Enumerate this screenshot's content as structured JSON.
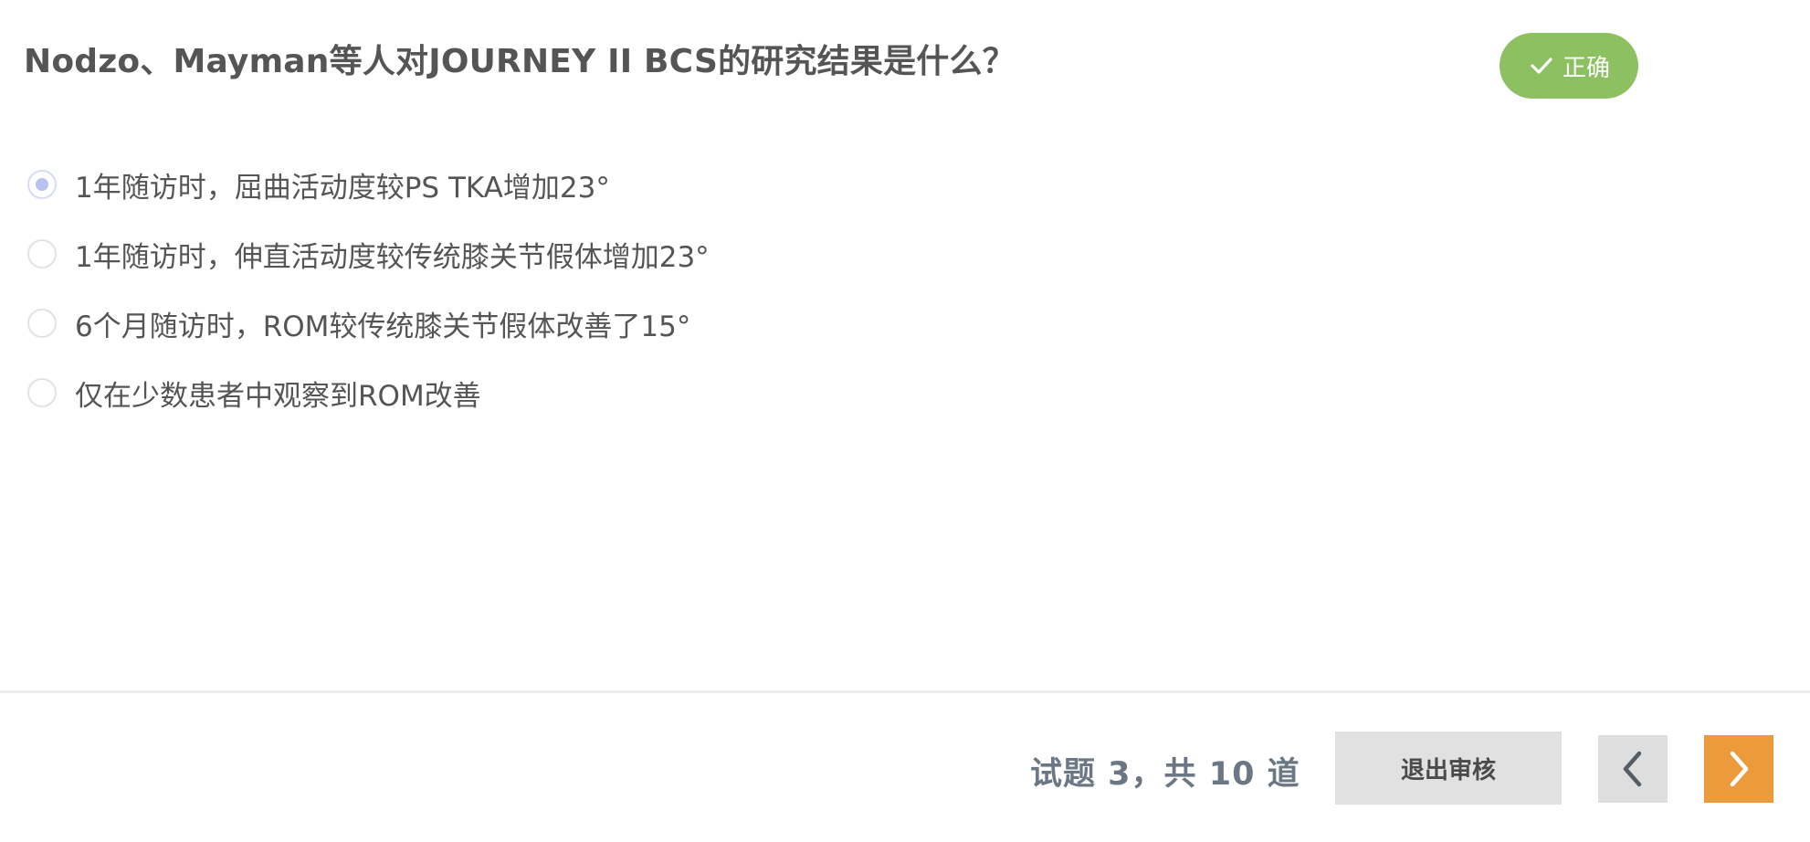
{
  "question": {
    "title": "Nodzo、Mayman等人对JOURNEY II BCS的研究结果是什么？"
  },
  "result": {
    "label": "正确",
    "icon": "check-icon",
    "color": "#8cc060"
  },
  "options": [
    {
      "label": "1年随访时，屈曲活动度较PS TKA增加23°",
      "selected": true
    },
    {
      "label": "1年随访时，伸直活动度较传统膝关节假体增加23°",
      "selected": false
    },
    {
      "label": "6个月随访时，ROM较传统膝关节假体改善了15°",
      "selected": false
    },
    {
      "label": "仅在少数患者中观察到ROM改善",
      "selected": false
    }
  ],
  "footer": {
    "progress_text": "试题 3，共 10 道",
    "exit_review_label": "退出审核",
    "prev_icon": "chevron-left-icon",
    "next_icon": "chevron-right-icon",
    "next_color": "#eb9b3c"
  }
}
